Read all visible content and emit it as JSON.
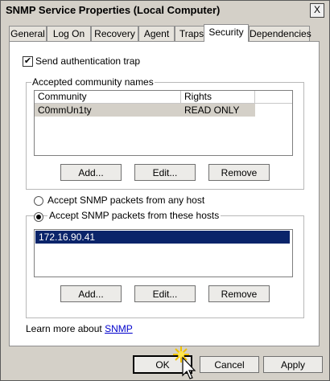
{
  "window": {
    "title": "SNMP Service Properties (Local Computer)",
    "close_glyph": "X"
  },
  "tabs": [
    {
      "label": "General"
    },
    {
      "label": "Log On"
    },
    {
      "label": "Recovery"
    },
    {
      "label": "Agent"
    },
    {
      "label": "Traps"
    },
    {
      "label": "Security"
    },
    {
      "label": "Dependencies"
    }
  ],
  "auth_trap": {
    "label": "Send authentication trap",
    "checked": true,
    "check_glyph": "✔"
  },
  "community": {
    "group_title": "Accepted community names",
    "headers": [
      "Community",
      "Rights"
    ],
    "rows": [
      {
        "community": "C0mmUn1ty",
        "rights": "READ ONLY"
      }
    ],
    "add": "Add...",
    "edit": "Edit...",
    "remove": "Remove"
  },
  "hosts": {
    "any_label": "Accept SNMP packets from any host",
    "these_label": "Accept SNMP packets from these hosts",
    "selected": "these",
    "items": [
      "172.16.90.41"
    ],
    "add": "Add...",
    "edit": "Edit...",
    "remove": "Remove"
  },
  "footer": {
    "learn_text": "Learn more about ",
    "learn_link": "SNMP"
  },
  "buttons": {
    "ok": "OK",
    "cancel": "Cancel",
    "apply": "Apply"
  },
  "colors": {
    "selection": "#0a246a",
    "selected_row_gray": "#d4d0c8",
    "link": "#0000cc"
  }
}
